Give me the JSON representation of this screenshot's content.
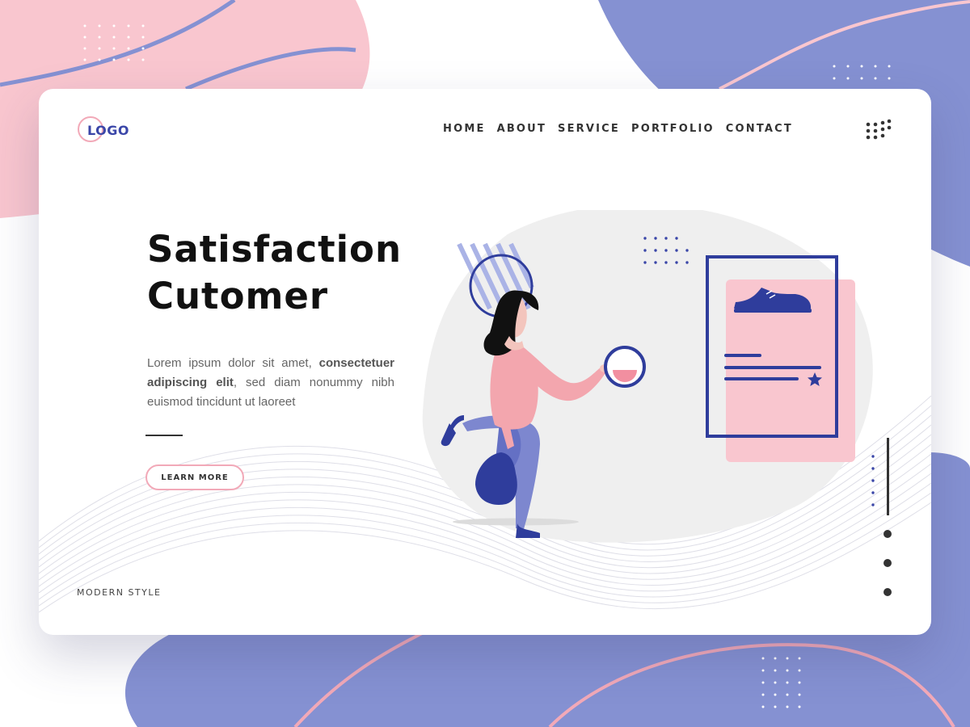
{
  "brand": {
    "logo_text": "LOGO"
  },
  "nav": {
    "items": [
      {
        "label": "HOME"
      },
      {
        "label": "ABOUT"
      },
      {
        "label": "SERVICE"
      },
      {
        "label": "PORTFOLIO"
      },
      {
        "label": "CONTACT"
      }
    ],
    "menu_icon": "grid-dots-icon"
  },
  "hero": {
    "title_line1": "Satisfaction",
    "title_line2": "Cutomer",
    "body_part1": "Lorem ipsum dolor sit amet, ",
    "body_bold": "consectetuer adipiscing elit",
    "body_part2": ", sed diam nonummy nibh euismod tincidunt ut laoreet",
    "cta_label": "LEARN MORE"
  },
  "footer": {
    "label": "MODERN STYLE"
  },
  "illustration": {
    "subject": "woman-running-with-shopping-bag",
    "card_icon": "sneaker-icon",
    "rating_icon": "star-icon"
  },
  "pagination": {
    "count": 3
  },
  "colors": {
    "pink": "#f9c6cf",
    "periwinkle": "#8591d2",
    "navy": "#2f3d9c",
    "blob": "#efefef",
    "text_dark": "#111111"
  }
}
